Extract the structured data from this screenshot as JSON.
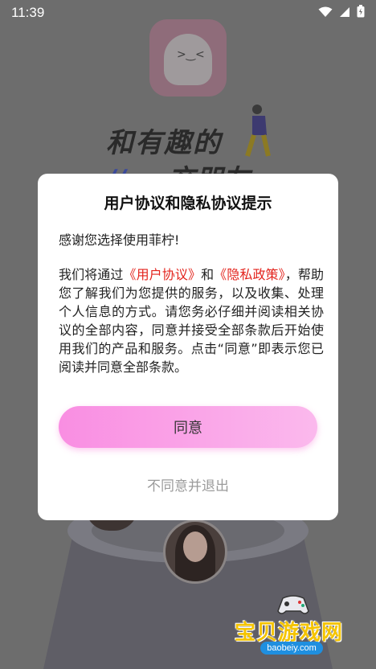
{
  "status_bar": {
    "time": "11:39",
    "icons": [
      "wifi-icon",
      "signal-icon",
      "battery-icon"
    ]
  },
  "background": {
    "slogan": "和有趣的",
    "slogan_partial": "交朋友"
  },
  "dialog": {
    "title": "用户协议和隐私协议提示",
    "greeting": "感谢您选择使用菲柠!",
    "body": {
      "prefix": "我们将通过",
      "user_agreement_link": "《用户协议》",
      "and": "和",
      "privacy_policy_link": "《隐私政策》",
      "suffix": "，帮助您了解我们为您提供的服务，以及收集、处理个人信息的方式。请您务必仔细并阅读相关协议的全部内容，同意并接受全部条款后开始使用我们的产品和服务。点击“同意”即表示您已阅读并同意全部条款。"
    },
    "agree_label": "同意",
    "disagree_label": "不同意并退出"
  },
  "watermark": {
    "brand": "宝贝游戏网",
    "url": "baobeiy.com"
  },
  "colors": {
    "link": "#e3231c",
    "agree_gradient_start": "#f98ee2",
    "agree_gradient_end": "#fbb9ed",
    "overlay": "#6d6d6d"
  }
}
